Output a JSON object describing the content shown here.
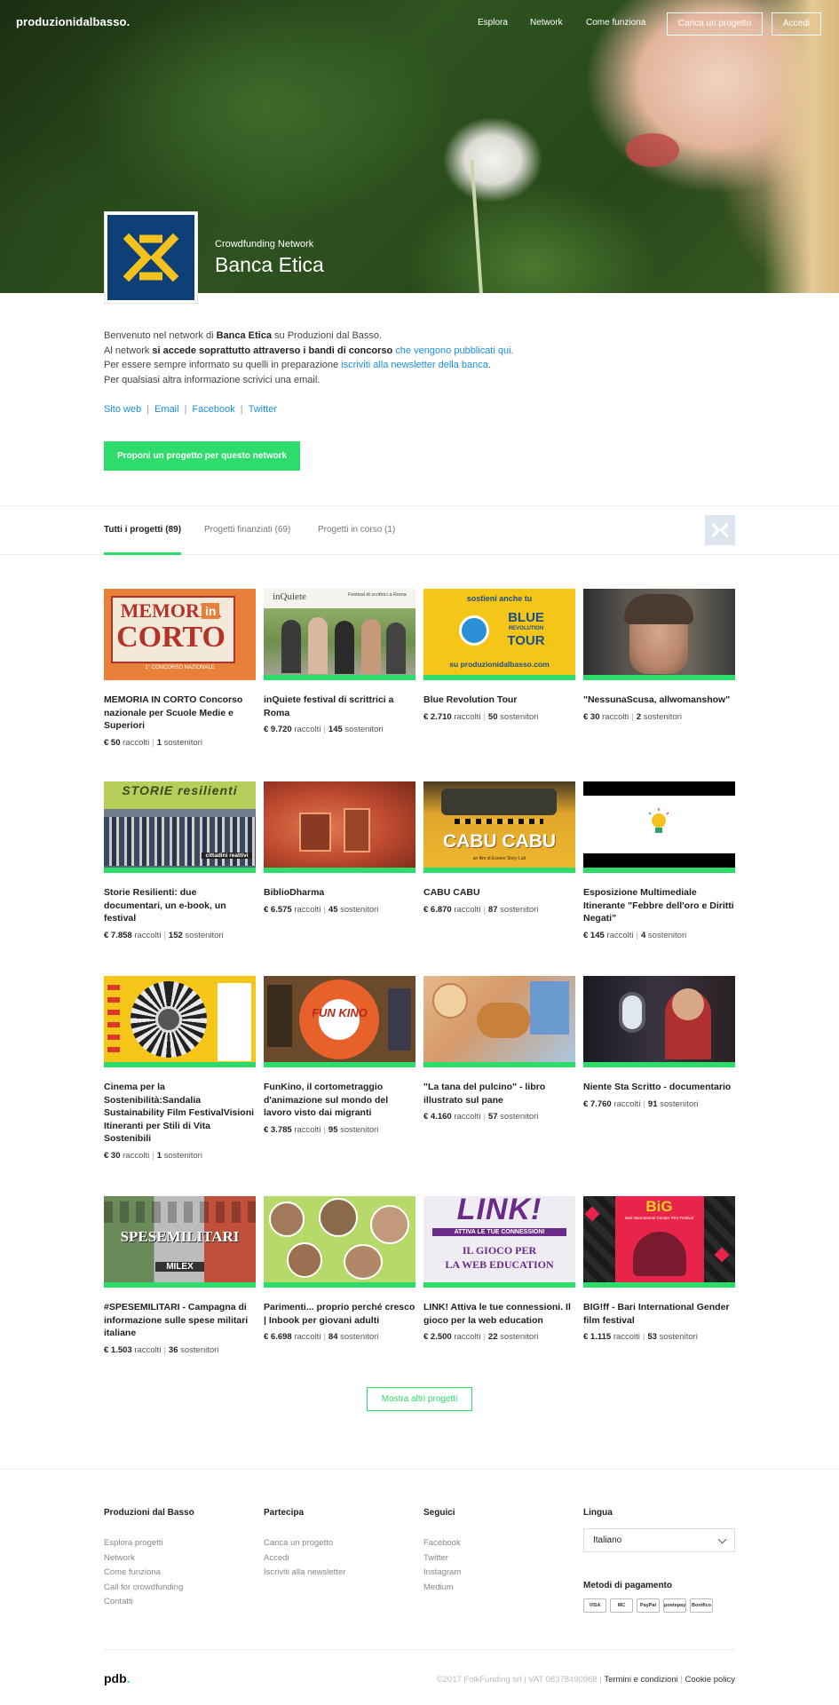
{
  "nav": {
    "brand": "produzionidalbasso.",
    "links": [
      "Esplora",
      "Network",
      "Come funziona"
    ],
    "upload_button": "Carica un progetto",
    "login_button": "Accedi"
  },
  "network": {
    "kicker": "Crowdfunding Network",
    "name": "Banca Etica",
    "logo_color": "#0e3f76",
    "logo_accent": "#f3c21c"
  },
  "intro": {
    "line1_a": "Benvenuto nel network di ",
    "line1_b": "Banca Etica",
    "line1_c": " su Produzioni dal Basso.",
    "line2_a": "Al network ",
    "line2_b": "si accede soprattutto attraverso i bandi di concorso",
    "line2_link": "che vengono pubblicati qui.",
    "line3_a": "Per essere sempre informato su quelli in preparazione ",
    "line3_link": "iscriviti alla newsletter della banca",
    "line3_c": ".",
    "line4": "Per qualsiasi altra informazione scrivici una email."
  },
  "social": [
    "Sito web",
    "Email",
    "Facebook",
    "Twitter"
  ],
  "cta": "Proponi un progetto per questo network",
  "tabs": [
    "Tutti i progetti (89)",
    "Progetti finanziati (69)",
    "Progetti in corso (1)"
  ],
  "stats_labels": {
    "raised": "raccolti",
    "backers": "sostenitori"
  },
  "projects": [
    {
      "title": "MEMORIA IN CORTO Concorso nazionale per Scuole Medie e Superiori",
      "raised": "€ 50",
      "backers": "1"
    },
    {
      "title": "inQuiete festival di scrittrici a Roma",
      "raised": "€ 9.720",
      "backers": "145"
    },
    {
      "title": "Blue Revolution Tour",
      "raised": "€ 2.710",
      "backers": "50"
    },
    {
      "title": "\"NessunaScusa, allwomanshow\"",
      "raised": "€ 30",
      "backers": "2"
    },
    {
      "title": "Storie Resilienti: due documentari, un e-book, un festival",
      "raised": "€ 7.858",
      "backers": "152"
    },
    {
      "title": "BiblioDharma",
      "raised": "€ 6.575",
      "backers": "45"
    },
    {
      "title": "CABU CABU",
      "raised": "€ 6.870",
      "backers": "87"
    },
    {
      "title": "Esposizione Multimediale Itinerante \"Febbre dell'oro e Diritti Negati\"",
      "raised": "€ 145",
      "backers": "4"
    },
    {
      "title": "Cinema per la Sostenibilità:Sandalia Sustainability Film FestivalVisioni Itineranti per Stili di Vita Sostenibili",
      "raised": "€ 30",
      "backers": "1"
    },
    {
      "title": "FunKino, il cortometraggio d'animazione sul mondo del lavoro visto dai migranti",
      "raised": "€ 3.785",
      "backers": "95"
    },
    {
      "title": "\"La tana del pulcino\" - libro illustrato sul pane",
      "raised": "€ 4.160",
      "backers": "57"
    },
    {
      "title": "Niente Sta Scritto - documentario",
      "raised": "€ 7.760",
      "backers": "91"
    },
    {
      "title": "#SPESEMILITARI - Campagna di informazione sulle spese militari italiane",
      "raised": "€ 1.503",
      "backers": "36"
    },
    {
      "title": "Parimenti... proprio perché cresco | Inbook per giovani adulti",
      "raised": "€ 6.698",
      "backers": "84"
    },
    {
      "title": "LINK! Attiva le tue connessioni. Il gioco per la web education",
      "raised": "€ 2.500",
      "backers": "22"
    },
    {
      "title": "BIG!ff - Bari International Gender film festival",
      "raised": "€ 1.115",
      "backers": "53"
    }
  ],
  "thumb_text": {
    "memoria_1": "MEMORIA",
    "memoria_in": "in",
    "memoria_2": "CORTO",
    "memoria_sub": "1° CONCORSO NAZIONALE",
    "inquiete_logo": "inQuiete",
    "inquiete_sub": "Festival di scrittrici a Roma",
    "blue_top": "sostieni anche tu",
    "blue_1": "BLUE",
    "blue_2": "REVOLUTION",
    "blue_3": "TOUR",
    "blue_bottom": "su produzionidalbasso.com",
    "storie": "STORIE resilienti",
    "storie_tag": "cittadini reattivi",
    "cabu": "CABU CABU",
    "cabu_sub": "un film di Essere Story Lab",
    "funkino": "FUN KINO",
    "spese": "SPESEMILITARI",
    "milex": "MILEX",
    "link_1": "LINK!",
    "link_2": "ATTIVA LE TUE CONNESSIONI",
    "link_3": "IL GIOCO PER",
    "link_4": "LA WEB EDUCATION",
    "big": "BiG",
    "big_sub": "Bari International Gender Film Festival"
  },
  "more_button": "Mostra altri progetti",
  "footer": {
    "col1": {
      "head": "Produzioni dal Basso",
      "links": [
        "Esplora progetti",
        "Network",
        "Come funziona",
        "Call for crowdfunding",
        "Contatti"
      ]
    },
    "col2": {
      "head": "Partecipa",
      "links": [
        "Carica un progetto",
        "Accedi",
        "Iscriviti alla newsletter"
      ]
    },
    "col3": {
      "head": "Seguici",
      "links": [
        "Facebook",
        "Twitter",
        "Instagram",
        "Medium"
      ]
    },
    "lang_head": "Lingua",
    "lang_value": "Italiano",
    "pay_head": "Metodi di pagamento",
    "pay_methods": [
      "VISA",
      "MC",
      "PayPal",
      "postepay",
      "Bonifico"
    ],
    "logo": "pdb",
    "logo_dot": ".",
    "copyright": "©2017 FolkFunding srl | VAT 08378490968 | ",
    "terms": "Termini e condizioni",
    "cookie_sep": " | ",
    "cookie": "Cookie policy"
  },
  "colors": {
    "accent": "#2ddc6a",
    "link": "#1a8fe0"
  }
}
